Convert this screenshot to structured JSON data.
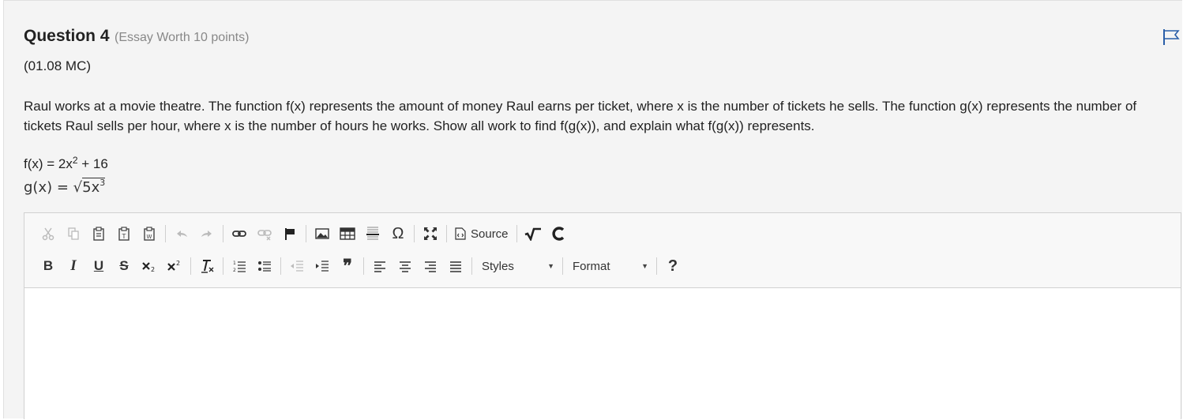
{
  "question": {
    "title": "Question 4",
    "worth": "(Essay Worth 10 points)",
    "code": "(01.08 MC)",
    "text": "Raul works at a movie theatre. The function f(x) represents the amount of money Raul earns per ticket, where x is the number of tickets he sells. The function g(x) represents the number of tickets Raul sells per hour, where x is the number of hours he works. Show all work to find f(g(x)), and explain what f(g(x)) represents.",
    "f_prefix": "f(x) = 2x",
    "f_exp": "2",
    "f_suffix": " + 16",
    "g_prefix": "g(x) = ",
    "g_radicand": "5x",
    "g_exp": "3"
  },
  "toolbar": {
    "source_label": "Source",
    "styles_label": "Styles",
    "format_label": "Format",
    "bold_label": "B",
    "italic_label": "I",
    "underline_label": "U",
    "strike_label": "S",
    "help_label": "?",
    "blockquote_label": "❞",
    "special_char_label": "Ω"
  },
  "colors": {
    "flag": "#2a5ea8",
    "panel_bg": "#f4f4f4",
    "toolbar_bg": "#f8f8f8"
  }
}
